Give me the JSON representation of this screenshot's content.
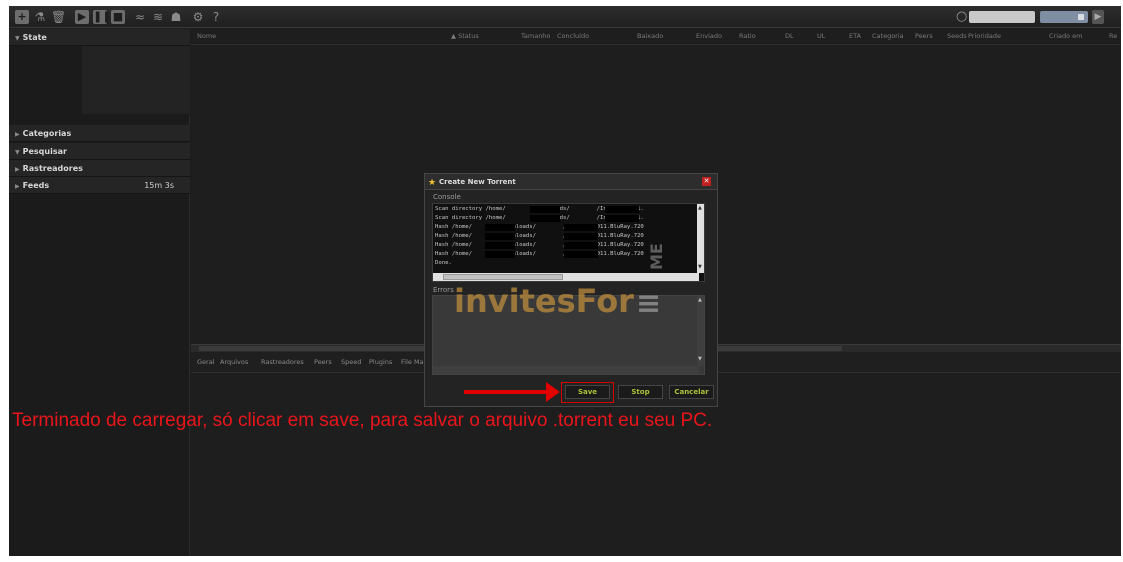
{
  "toolbar": {
    "icons": [
      "add-torrent-icon",
      "create-torrent-icon",
      "remove-icon",
      "start-icon",
      "pause-icon",
      "stop-icon",
      "rss-icon",
      "rss-icon",
      "plugin-icon",
      "settings-icon",
      "help-icon"
    ],
    "help_label": "?"
  },
  "sidebar": {
    "state": "State",
    "categorias": "Categorias",
    "pesquisar": "Pesquisar",
    "rastreadores": "Rastreadores",
    "feeds": "Feeds",
    "feeds_count": "15m 3s"
  },
  "table": {
    "columns": [
      "Nome",
      "▲ Status",
      "Tamanho",
      "Concluído",
      "Baixado",
      "Enviado",
      "Ratio",
      "DL",
      "UL",
      "ETA",
      "Categoria",
      "Peers",
      "Seeds",
      "Prioridade",
      "Criado em",
      "Re"
    ]
  },
  "tabs": [
    "Geral",
    "Arquivos",
    "Rastreadores",
    "Peers",
    "Speed",
    "Plugins",
    "File Ma"
  ],
  "dialog": {
    "title": "Create New Torrent",
    "console_label": "Console",
    "console_lines": [
      "Scan directory /home/        /downloads/        /In.Time.2011.",
      "Scan directory /home/        /downloads/        /In.Time.2011.",
      "Hash /home/        /downloads/        /In.Time.2011.BluRay.720",
      "Hash /home/        /downloads/        /In.Time.2011.BluRay.720",
      "Hash /home/        /downloads/        /In.Time.2011.BluRay.720",
      "Hash /home/        /downloads/        /In.Time.2011.BluRay.720",
      "Done."
    ],
    "errors_label": "Errors",
    "save_label": "Save",
    "stop_label": "Stop",
    "cancel_label": "Cancelar"
  },
  "watermark": "invitesFor",
  "watermark_suffix": "≡",
  "watermark_vertical": "ME",
  "caption": "Terminado de carregar, só clicar em save, para salvar o arquivo .torrent eu seu PC.",
  "colors": {
    "accent": "#a9c23a",
    "annotation": "#e8151b"
  }
}
